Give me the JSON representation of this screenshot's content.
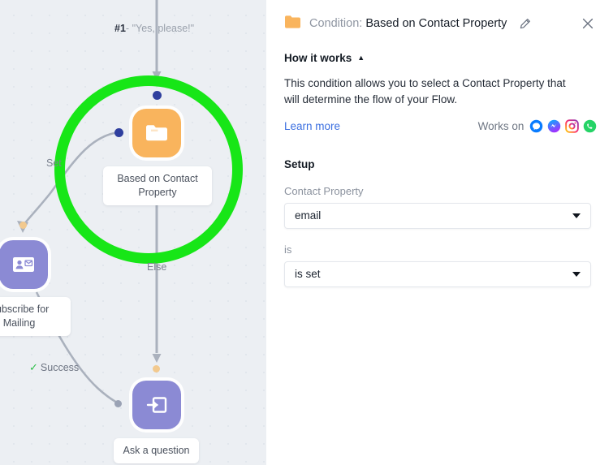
{
  "canvas": {
    "flow_step": {
      "number": "#1",
      "dash": "-",
      "message": "\"Yes, please!\""
    },
    "nodes": [
      {
        "id": "condition",
        "label": "Based on Contact Property",
        "icon": "folder-icon",
        "color": "#f9b45d"
      },
      {
        "id": "subscribe",
        "label": "Subscribe for Mailing",
        "icon": "contact-card-icon",
        "color": "#8b8ad4"
      },
      {
        "id": "ask",
        "label": "Ask a question",
        "icon": "ask-question-icon",
        "color": "#8b8ad4"
      }
    ],
    "branch_labels": {
      "set": "Set",
      "else": "Else"
    },
    "success_label": "Success",
    "highlight_color": "#17e617"
  },
  "panel": {
    "header": {
      "icon": "folder-icon",
      "label": "Condition:",
      "value": "Based on Contact Property",
      "edit_icon": "pencil-icon",
      "close_icon": "close-icon"
    },
    "how_it_works": {
      "title": "How it works",
      "collapse_icon": "caret-up-icon",
      "description": "This condition allows you to select a Contact Property that will determine the flow of your Flow.",
      "learn_more": "Learn more",
      "works_on_label": "Works on",
      "channels": [
        "chat-bubble-icon",
        "messenger-icon",
        "instagram-icon",
        "whatsapp-icon"
      ]
    },
    "setup": {
      "title": "Setup",
      "fields": [
        {
          "label": "Contact Property",
          "value": "email",
          "caret": "chevron-down-icon"
        },
        {
          "label": "is",
          "value": "is set",
          "caret": "chevron-down-icon"
        }
      ]
    }
  }
}
